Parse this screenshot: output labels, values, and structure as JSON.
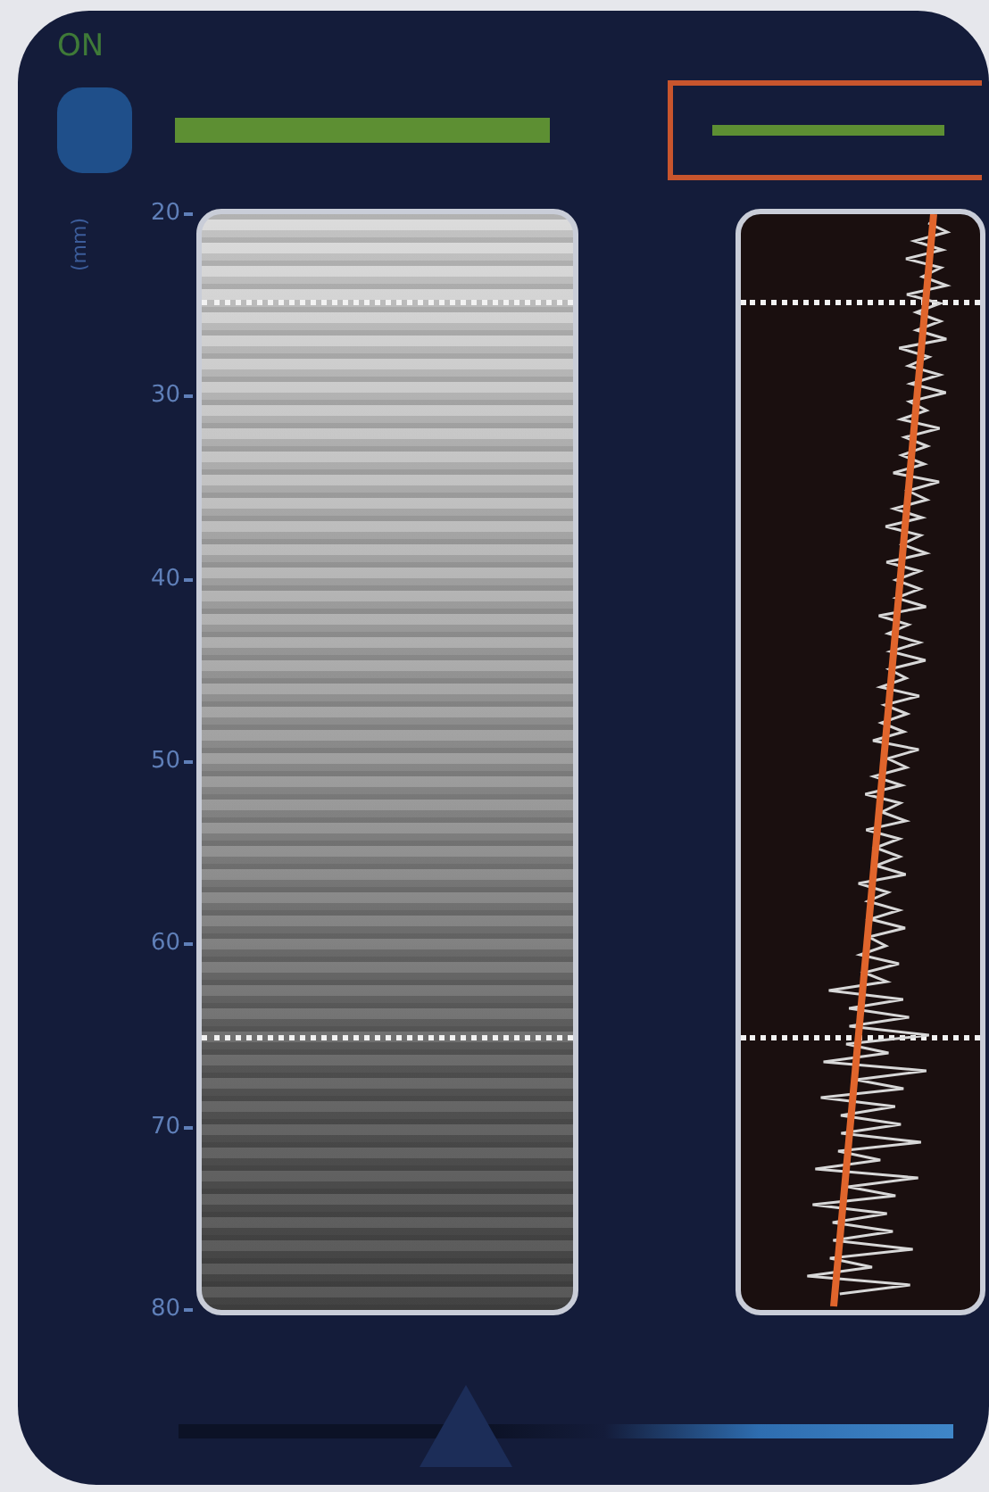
{
  "status": {
    "label": "ON"
  },
  "depth_axis": {
    "unit": "(mm)",
    "ticks": [
      "20",
      "30",
      "40",
      "50",
      "60",
      "70",
      "80"
    ]
  },
  "bottom_slider": {
    "level": 0.37
  }
}
